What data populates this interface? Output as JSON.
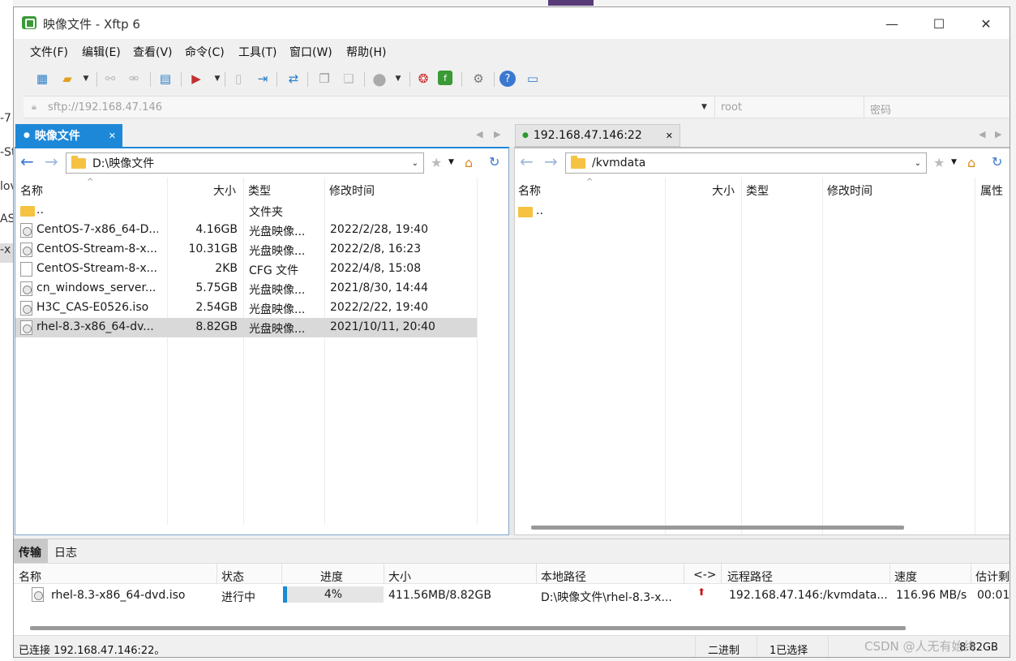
{
  "window": {
    "title": "映像文件 - Xftp 6"
  },
  "menu": [
    "文件(F)",
    "编辑(E)",
    "查看(V)",
    "命令(C)",
    "工具(T)",
    "窗口(W)",
    "帮助(H)"
  ],
  "address": {
    "url": "sftp://192.168.47.146",
    "user_placeholder": "root",
    "password_placeholder": "密码"
  },
  "left": {
    "tab_label": "映像文件",
    "path": "D:\\映像文件",
    "columns": [
      "名称",
      "大小",
      "类型",
      "修改时间"
    ],
    "files": [
      {
        "name": "..",
        "size": "",
        "type": "文件夹",
        "modified": "",
        "icon": "folder"
      },
      {
        "name": "CentOS-7-x86_64-D...",
        "size": "4.16GB",
        "type": "光盘映像...",
        "modified": "2022/2/28, 19:40",
        "icon": "disc"
      },
      {
        "name": "CentOS-Stream-8-x...",
        "size": "10.31GB",
        "type": "光盘映像...",
        "modified": "2022/2/8, 16:23",
        "icon": "disc"
      },
      {
        "name": "CentOS-Stream-8-x...",
        "size": "2KB",
        "type": "CFG 文件",
        "modified": "2022/4/8, 15:08",
        "icon": "file"
      },
      {
        "name": "cn_windows_server...",
        "size": "5.75GB",
        "type": "光盘映像...",
        "modified": "2021/8/30, 14:44",
        "icon": "disc"
      },
      {
        "name": "H3C_CAS-E0526.iso",
        "size": "2.54GB",
        "type": "光盘映像...",
        "modified": "2022/2/22, 19:40",
        "icon": "disc"
      },
      {
        "name": "rhel-8.3-x86_64-dv...",
        "size": "8.82GB",
        "type": "光盘映像...",
        "modified": "2021/10/11, 20:40",
        "icon": "disc"
      }
    ]
  },
  "right": {
    "tab_label": "192.168.47.146:22",
    "path": "/kvmdata",
    "columns": [
      "名称",
      "大小",
      "类型",
      "修改时间",
      "属性"
    ],
    "files": [
      {
        "name": "..",
        "icon": "folder"
      }
    ]
  },
  "bottom_tabs": [
    "传输",
    "日志"
  ],
  "transfer": {
    "columns": [
      "名称",
      "状态",
      "进度",
      "大小",
      "本地路径",
      "<->",
      "远程路径",
      "速度",
      "估计剩"
    ],
    "row": {
      "name": "rhel-8.3-x86_64-dvd.iso",
      "status": "进行中",
      "progress_text": "4%",
      "progress": 0.04,
      "size": "411.56MB/8.82GB",
      "local": "D:\\映像文件\\rhel-8.3-x...",
      "remote": "192.168.47.146:/kvmdata...",
      "speed": "116.96 MB/s",
      "eta": "00:01:"
    }
  },
  "status": {
    "connected": "已连接 192.168.47.146:22。",
    "mode": "二进制",
    "selected": "1已选择",
    "size": "8.82GB"
  },
  "watermark": "CSDN @人无有始终",
  "colors": {
    "accent": "#1a8ad4",
    "tab_active": "#1e88d8",
    "selected_row": "#d9d9d9"
  }
}
